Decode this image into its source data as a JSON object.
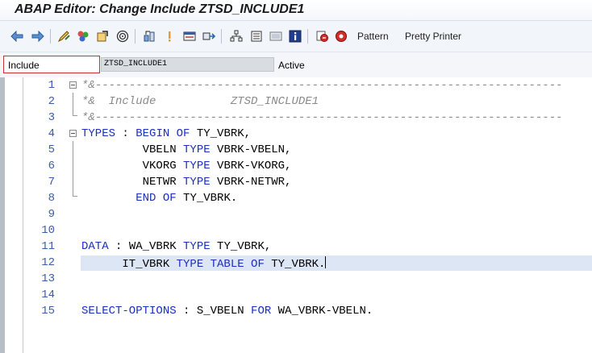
{
  "window": {
    "title": "ABAP Editor: Change Include ZTSD_INCLUDE1"
  },
  "toolbar": {
    "icons": [
      "back-arrow-icon",
      "forward-arrow-icon",
      "display-change-icon",
      "other-object-icon",
      "check-icon",
      "activate-icon",
      "test-icon",
      "where-used-icon",
      "object-list-icon",
      "navigation-window-icon",
      "find-icon",
      "display-object-icon",
      "help-icon",
      "breakpoint-icon",
      "breakpoint-alt-icon"
    ],
    "pattern_label": "Pattern",
    "pretty_printer_label": "Pretty Printer"
  },
  "include_field": {
    "label": "Include",
    "value": "ZTSD_INCLUDE1",
    "status": "Active"
  },
  "editor": {
    "current_line": 12,
    "lines": [
      {
        "num": "1",
        "segments": [
          {
            "t": "*&",
            "c": "cm"
          },
          {
            "t": "---------------------------------------------------------------------",
            "c": "cm"
          }
        ]
      },
      {
        "num": "2",
        "segments": [
          {
            "t": "*&  Include           ZTSD_INCLUDE1",
            "c": "cm"
          }
        ]
      },
      {
        "num": "3",
        "segments": [
          {
            "t": "*&",
            "c": "cm"
          },
          {
            "t": "---------------------------------------------------------------------",
            "c": "cm"
          }
        ]
      },
      {
        "num": "4",
        "segments": [
          {
            "t": "TYPES",
            "c": "kw"
          },
          {
            "t": " : ",
            "c": ""
          },
          {
            "t": "BEGIN OF",
            "c": "kw"
          },
          {
            "t": " TY_VBRK,",
            "c": ""
          }
        ]
      },
      {
        "num": "5",
        "segments": [
          {
            "t": "         VBELN ",
            "c": ""
          },
          {
            "t": "TYPE",
            "c": "kw"
          },
          {
            "t": " VBRK-VBELN,",
            "c": ""
          }
        ]
      },
      {
        "num": "6",
        "segments": [
          {
            "t": "         VKORG ",
            "c": ""
          },
          {
            "t": "TYPE",
            "c": "kw"
          },
          {
            "t": " VBRK-VKORG,",
            "c": ""
          }
        ]
      },
      {
        "num": "7",
        "segments": [
          {
            "t": "         NETWR ",
            "c": ""
          },
          {
            "t": "TYPE",
            "c": "kw"
          },
          {
            "t": " VBRK-NETWR,",
            "c": ""
          }
        ]
      },
      {
        "num": "8",
        "segments": [
          {
            "t": "        ",
            "c": ""
          },
          {
            "t": "END OF",
            "c": "kw"
          },
          {
            "t": " TY_VBRK.",
            "c": ""
          }
        ]
      },
      {
        "num": "9",
        "segments": []
      },
      {
        "num": "10",
        "segments": []
      },
      {
        "num": "11",
        "segments": [
          {
            "t": "DATA",
            "c": "kw"
          },
          {
            "t": " : WA_VBRK ",
            "c": ""
          },
          {
            "t": "TYPE",
            "c": "kw"
          },
          {
            "t": " TY_VBRK,",
            "c": ""
          }
        ]
      },
      {
        "num": "12",
        "segments": [
          {
            "t": "      IT_VBRK ",
            "c": ""
          },
          {
            "t": "TYPE TABLE OF",
            "c": "kw"
          },
          {
            "t": " TY_VBRK.",
            "c": ""
          }
        ]
      },
      {
        "num": "13",
        "segments": []
      },
      {
        "num": "14",
        "segments": []
      },
      {
        "num": "15",
        "segments": [
          {
            "t": "SELECT-OPTIONS",
            "c": "kw"
          },
          {
            "t": " : S_VBELN ",
            "c": ""
          },
          {
            "t": "FOR",
            "c": "kw"
          },
          {
            "t": " WA_VBRK-VBELN.",
            "c": ""
          }
        ]
      }
    ]
  }
}
